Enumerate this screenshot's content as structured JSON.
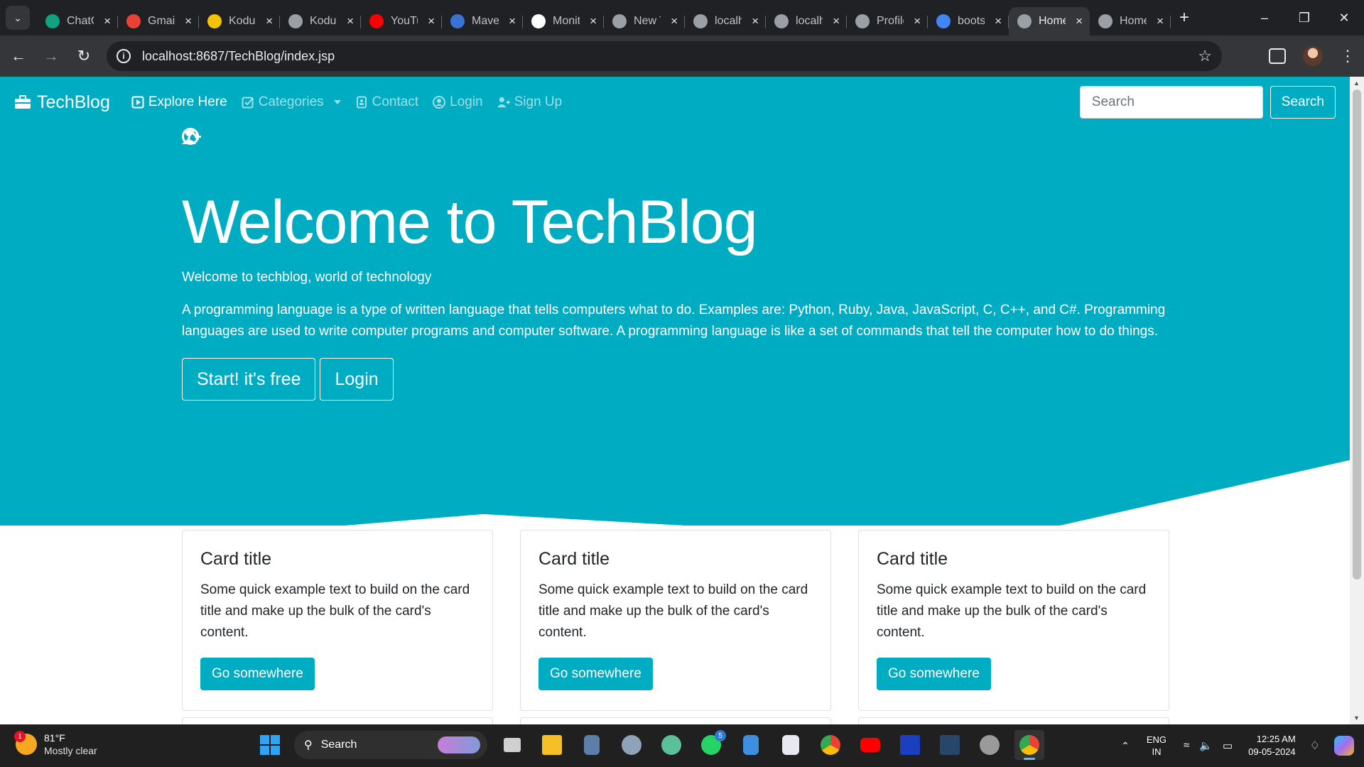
{
  "browser": {
    "tabs": [
      {
        "title": "ChatGPT",
        "favicon": "chatgpt-icon",
        "color": "#10a37f"
      },
      {
        "title": "Gmail",
        "favicon": "gmail-icon",
        "color": "#ea4335"
      },
      {
        "title": "Kodular",
        "favicon": "kodular-icon",
        "color": "#f5c400"
      },
      {
        "title": "Kodular",
        "favicon": "globe-icon",
        "color": "#9aa0a6"
      },
      {
        "title": "YouTube",
        "favicon": "youtube-icon",
        "color": "#ff0000"
      },
      {
        "title": "Maven",
        "favicon": "maven-icon",
        "color": "#3b73d4"
      },
      {
        "title": "Monitor",
        "favicon": "github-icon",
        "color": "#ffffff"
      },
      {
        "title": "New Tab",
        "favicon": "chrome-icon",
        "color": "#9aa0a6"
      },
      {
        "title": "localhost",
        "favicon": "globe-icon",
        "color": "#9aa0a6"
      },
      {
        "title": "localhost",
        "favicon": "globe-icon",
        "color": "#9aa0a6"
      },
      {
        "title": "Profile",
        "favicon": "globe-icon",
        "color": "#9aa0a6"
      },
      {
        "title": "bootstrap",
        "favicon": "google-icon",
        "color": "#4285f4"
      },
      {
        "title": "Home",
        "favicon": "globe-icon",
        "color": "#9aa0a6",
        "active": true
      },
      {
        "title": "Home",
        "favicon": "globe-icon",
        "color": "#9aa0a6"
      }
    ],
    "url": "localhost:8687/TechBlog/index.jsp"
  },
  "navbar": {
    "brand": "TechBlog",
    "items": [
      "Explore Here",
      "Categories",
      "Contact",
      "Login",
      "Sign Up"
    ],
    "search_placeholder": "Search",
    "search_button": "Search"
  },
  "hero": {
    "title": "Welcome to TechBlog",
    "subtitle": "Welcome to techblog, world of technology",
    "description": "A programming language is a type of written language that tells computers what to do. Examples are: Python, Ruby, Java, JavaScript, C, C++, and C#. Programming languages are used to write computer programs and computer software. A programming language is like a set of commands that tell the computer how to do things.",
    "start_button": "Start! it's free",
    "login_button": "Login"
  },
  "cards": [
    {
      "title": "Card title",
      "text": "Some quick example text to build on the card title and make up the bulk of the card's content.",
      "button": "Go somewhere"
    },
    {
      "title": "Card title",
      "text": "Some quick example text to build on the card title and make up the bulk of the card's content.",
      "button": "Go somewhere"
    },
    {
      "title": "Card title",
      "text": "Some quick example text to build on the card title and make up the bulk of the card's content.",
      "button": "Go somewhere"
    }
  ],
  "taskbar": {
    "weather_badge": "1",
    "temperature": "81°F",
    "condition": "Mostly clear",
    "search_label": "Search",
    "whatsapp_badge": "5",
    "lang_line1": "ENG",
    "lang_line2": "IN",
    "time": "12:25 AM",
    "date": "09-05-2024"
  },
  "colors": {
    "accent": "#00acc1",
    "chrome_dark": "#202124",
    "chrome_toolbar": "#35363a",
    "taskbar": "#202020"
  }
}
